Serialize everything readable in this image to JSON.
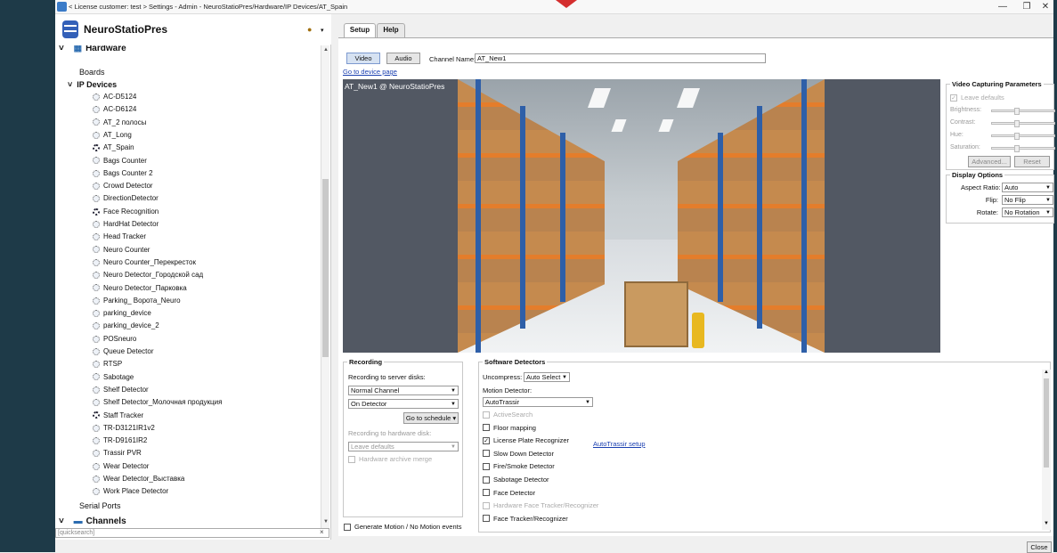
{
  "window": {
    "title": "< License customer: test > Settings - Admin - NeuroStatioPres/Hardware/IP Devices/AT_Spain",
    "minimize": "—",
    "maximize": "❐",
    "close": "✕"
  },
  "sidebar": {
    "brand": "NeuroStatioPres",
    "quicksearch_placeholder": "[quicksearch]",
    "hardware": "Hardware",
    "boards": "Boards",
    "ip_devices": "IP Devices",
    "devices": [
      "AC-D5124",
      "AC-D6124",
      "AT_2 полосы",
      "AT_Long",
      "AT_Spain",
      "Bags Counter",
      "Bags Counter 2",
      "Crowd Detector",
      "DirectionDetector",
      "Face Recognition",
      "HardHat Detector",
      "Head Tracker",
      "Neuro Counter",
      "Neuro Counter_Перекресток",
      "Neuro Detector_Городской сад",
      "Neuro Detector_Парковка",
      "Parking_ Ворота_Neuro",
      "parking_device",
      "parking_device_2",
      "POSneuro",
      "Queue Detector",
      "RTSP",
      "Sabotage",
      "Shelf Detector",
      "Shelf Detector_Молочная продукция",
      "Staff Tracker",
      "TR-D3121IR1v2",
      "TR-D9161IR2",
      "Trassir PVR",
      "Wear Detector",
      "Wear Detector_Выставка",
      "Work Place Detector"
    ],
    "serial_ports": "Serial Ports",
    "channels": "Channels"
  },
  "tabs": [
    "Setup",
    "Help"
  ],
  "setup": {
    "video_btn": "Video",
    "audio_btn": "Audio",
    "channel_name_label": "Channel Name:",
    "channel_name_value": "AT_New1",
    "go_to_device_page": "Go to device page",
    "video_overlay": "AT_New1 @ NeuroStatioPres"
  },
  "video_params": {
    "title": "Video Capturing Parameters",
    "leave_defaults": "Leave defaults",
    "brightness": "Brightness:",
    "contrast": "Contrast:",
    "hue": "Hue:",
    "saturation": "Saturation:",
    "advanced": "Advanced...",
    "reset": "Reset"
  },
  "display_options": {
    "title": "Display Options",
    "aspect_ratio_label": "Aspect Ratio:",
    "aspect_ratio_value": "Auto",
    "flip_label": "Flip:",
    "flip_value": "No Flip",
    "rotate_label": "Rotate:",
    "rotate_value": "No Rotation"
  },
  "recording": {
    "title": "Recording",
    "to_server_label": "Recording to server disks:",
    "channel_value": "Normal Channel",
    "mode_value": "On Detector",
    "go_to_schedule": "Go to schedule",
    "to_hardware_label": "Recording to hardware disk:",
    "hardware_value": "Leave defaults",
    "hardware_merge": "Hardware archive merge"
  },
  "generate_motion": "Generate Motion / No Motion events",
  "software_detectors": {
    "title": "Software Detectors",
    "uncompress_label": "Uncompress:",
    "uncompress_value": "Auto Select",
    "motion_label": "Motion Detector:",
    "motion_value": "AutoTrassir",
    "items": [
      {
        "label": "ActiveSearch",
        "checked": false,
        "disabled": true
      },
      {
        "label": "Floor mapping",
        "checked": false,
        "disabled": false
      },
      {
        "label": "License Plate Recognizer",
        "checked": true,
        "disabled": false
      },
      {
        "label": "Slow Down Detector",
        "checked": false,
        "disabled": false
      },
      {
        "label": "Fire/Smoke Detector",
        "checked": false,
        "disabled": false
      },
      {
        "label": "Sabotage Detector",
        "checked": false,
        "disabled": false
      },
      {
        "label": "Face Detector",
        "checked": false,
        "disabled": false
      },
      {
        "label": "Hardware Face Tracker/Recognizer",
        "checked": false,
        "disabled": true
      },
      {
        "label": "Face Tracker/Recognizer",
        "checked": false,
        "disabled": false
      }
    ],
    "autotrassir_link": "AutoTrassir setup"
  },
  "close_btn": "Close",
  "colors": {
    "sidebar_dark": "#1e3a48",
    "accent_red": "#d42e2e",
    "link": "#1a3fb0"
  }
}
